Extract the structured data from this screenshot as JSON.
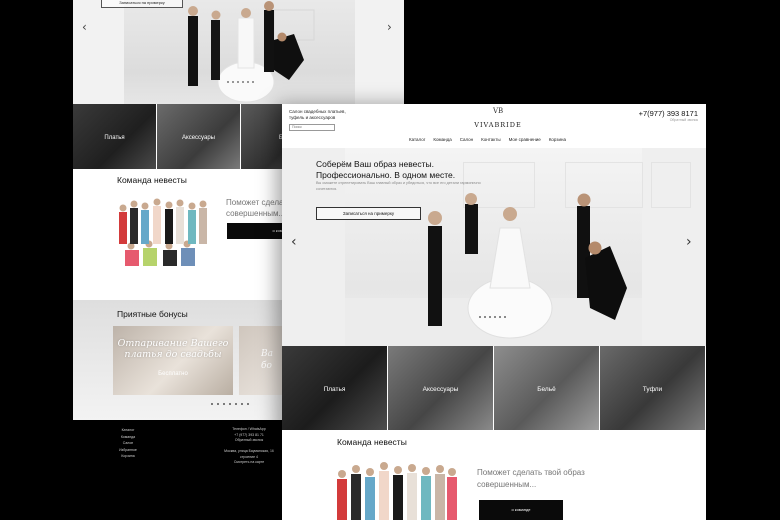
{
  "back": {
    "hero_button": "Записаться на примерку",
    "categories": [
      "Платья",
      "Аксессуары",
      "Бе"
    ],
    "team_title": "Команда невесты",
    "team_text": "Поможет сделать совершенным...",
    "team_button": "о команде",
    "bonus_title": "Приятные бонусы",
    "bonus_card_title": "Отпаривание Вашего платья до свадьбы",
    "bonus_card_sub": "Бесплатно",
    "bonus_card2_title": "Ва бо",
    "footer_nav": [
      "Каталог",
      "Команда",
      "Салон",
      "Избранное",
      "Корзина"
    ],
    "footer_contacts": [
      "Телефон / WhatsApp",
      "+7 (977) 393 81 71",
      "Обратный звонок",
      "",
      "Москва, улица Бауманская, 16 строение 4",
      "Смотреть на карте"
    ]
  },
  "front": {
    "salon_text": "Салон свадебных платьев, туфель и аксессуаров",
    "search_placeholder": "Поиск",
    "logo_mark": "VB",
    "logo": "VIVABRIDE",
    "phone": "+7(977) 393 8171",
    "phone_sub": "Обратный звонок",
    "nav": [
      "Каталог",
      "Команда",
      "Салон",
      "Контакты",
      "Мое сравнение",
      "Корзина"
    ],
    "hero_title_1": "Соберём Ваш образ невесты.",
    "hero_title_2": "Профессионально. В одном месте.",
    "hero_sub": "Вы сможете отрепетировать Ваш главный образ и убедиться, что все его детали гармонично сочетаются.",
    "hero_button": "Записаться на примерку",
    "categories": [
      "Платья",
      "Аксессуары",
      "Бельё",
      "Туфли"
    ],
    "team_title": "Команда невесты",
    "team_text": "Поможет сделать твой образ совершенным...",
    "team_button": "о команде"
  },
  "icons": {
    "arrow_left": "chevron-left-icon",
    "arrow_right": "chevron-right-icon"
  },
  "colors": {
    "background": "#000000",
    "accent": "#0a0a0a",
    "text": "#111111",
    "muted": "#777777"
  }
}
